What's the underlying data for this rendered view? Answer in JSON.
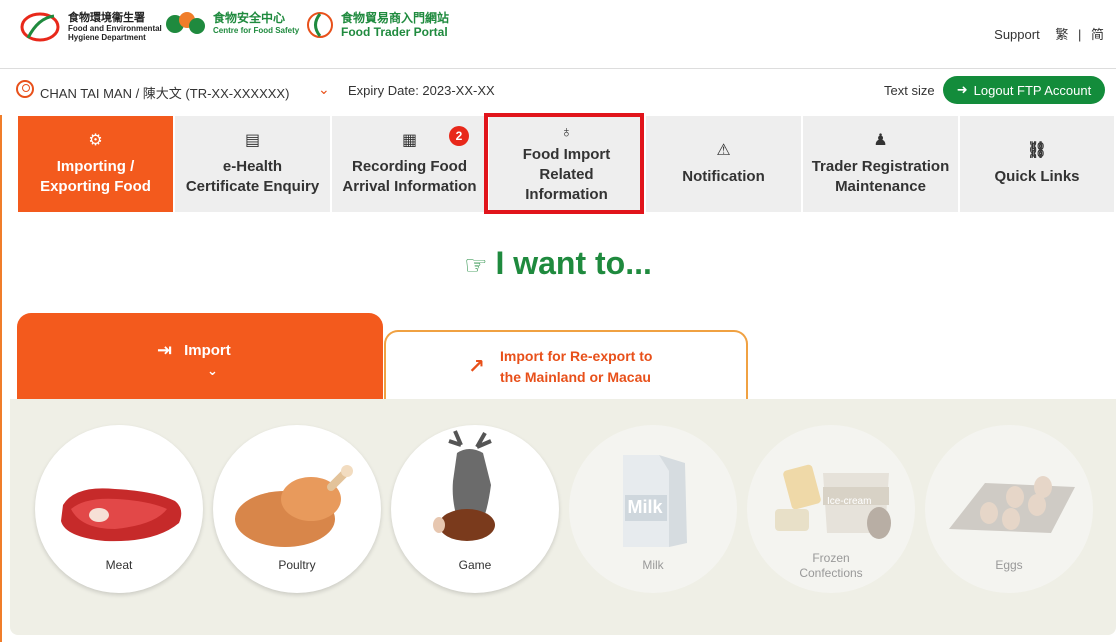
{
  "header": {
    "logo1": {
      "line1": "食物環境衞生署",
      "line2": "Food and Environmental",
      "line3": "Hygiene Department"
    },
    "logo2": {
      "line1": "食物安全中心",
      "line2": "Centre for Food Safety"
    },
    "logo3": {
      "line1": "食物貿易商入門網站",
      "line2": "Food Trader Portal"
    },
    "support": "Support",
    "lang_trad": "繁",
    "lang_sep": "|",
    "lang_simp": "简"
  },
  "userbar": {
    "user_name": "CHAN TAI MAN / 陳大文 (TR-XX-XXXXXX)",
    "expiry": "Expiry Date: 2023-XX-XX",
    "text_size": "Text size",
    "logout": "Logout FTP Account"
  },
  "nav": {
    "tabs": [
      {
        "label1": "Importing /",
        "label2": "Exporting Food",
        "icon": "cogs-icon"
      },
      {
        "label1": "e-Health",
        "label2": "Certificate Enquiry",
        "icon": "document-check-icon"
      },
      {
        "label1": "Recording Food",
        "label2": "Arrival Information",
        "icon": "server-icon",
        "badge": "2"
      },
      {
        "label1": "Food Import",
        "label2": "Related",
        "label3": "Information",
        "icon": "hot-air-balloon-icon"
      },
      {
        "label1": "Notification",
        "icon": "alarm-icon"
      },
      {
        "label1": "Trader Registration",
        "label2": "Maintenance",
        "icon": "person-icon"
      },
      {
        "label1": "Quick Links",
        "icon": "link-icon"
      }
    ]
  },
  "want_to": "I want to...",
  "import_tabs": {
    "import": "Import",
    "reexport1": "Import for Re-export to",
    "reexport2": "the Mainland or Macau"
  },
  "categories": [
    {
      "label": "Meat",
      "enabled": true,
      "icon": "meat-icon"
    },
    {
      "label": "Poultry",
      "enabled": true,
      "icon": "poultry-icon"
    },
    {
      "label": "Game",
      "enabled": true,
      "icon": "game-icon"
    },
    {
      "label": "Milk",
      "enabled": false,
      "icon": "milk-icon",
      "image_text": "Milk"
    },
    {
      "label": "Frozen",
      "label2": "Confections",
      "enabled": false,
      "icon": "frozen-confections-icon",
      "image_text": "Ice-cream"
    },
    {
      "label": "Eggs",
      "enabled": false,
      "icon": "eggs-icon"
    }
  ],
  "colors": {
    "accent": "#f35a1d",
    "green": "#138c3b",
    "highlight": "#e1141b"
  }
}
